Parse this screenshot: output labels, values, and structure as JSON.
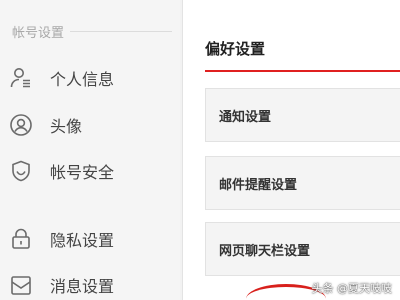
{
  "sidebar": {
    "section_title": "帐号设置",
    "items": [
      {
        "label": "个人信息",
        "icon": "user-icon"
      },
      {
        "label": "头像",
        "icon": "avatar-icon"
      },
      {
        "label": "帐号安全",
        "icon": "shield-icon"
      },
      {
        "label": "隐私设置",
        "icon": "lock-icon"
      },
      {
        "label": "消息设置",
        "icon": "message-icon"
      }
    ]
  },
  "main": {
    "title": "偏好设置",
    "accent_color": "#e02020",
    "rows": [
      {
        "label": "通知设置"
      },
      {
        "label": "邮件提醒设置"
      },
      {
        "label": "网页聊天栏设置"
      }
    ]
  },
  "watermark": "头条 @夏天吱吱"
}
